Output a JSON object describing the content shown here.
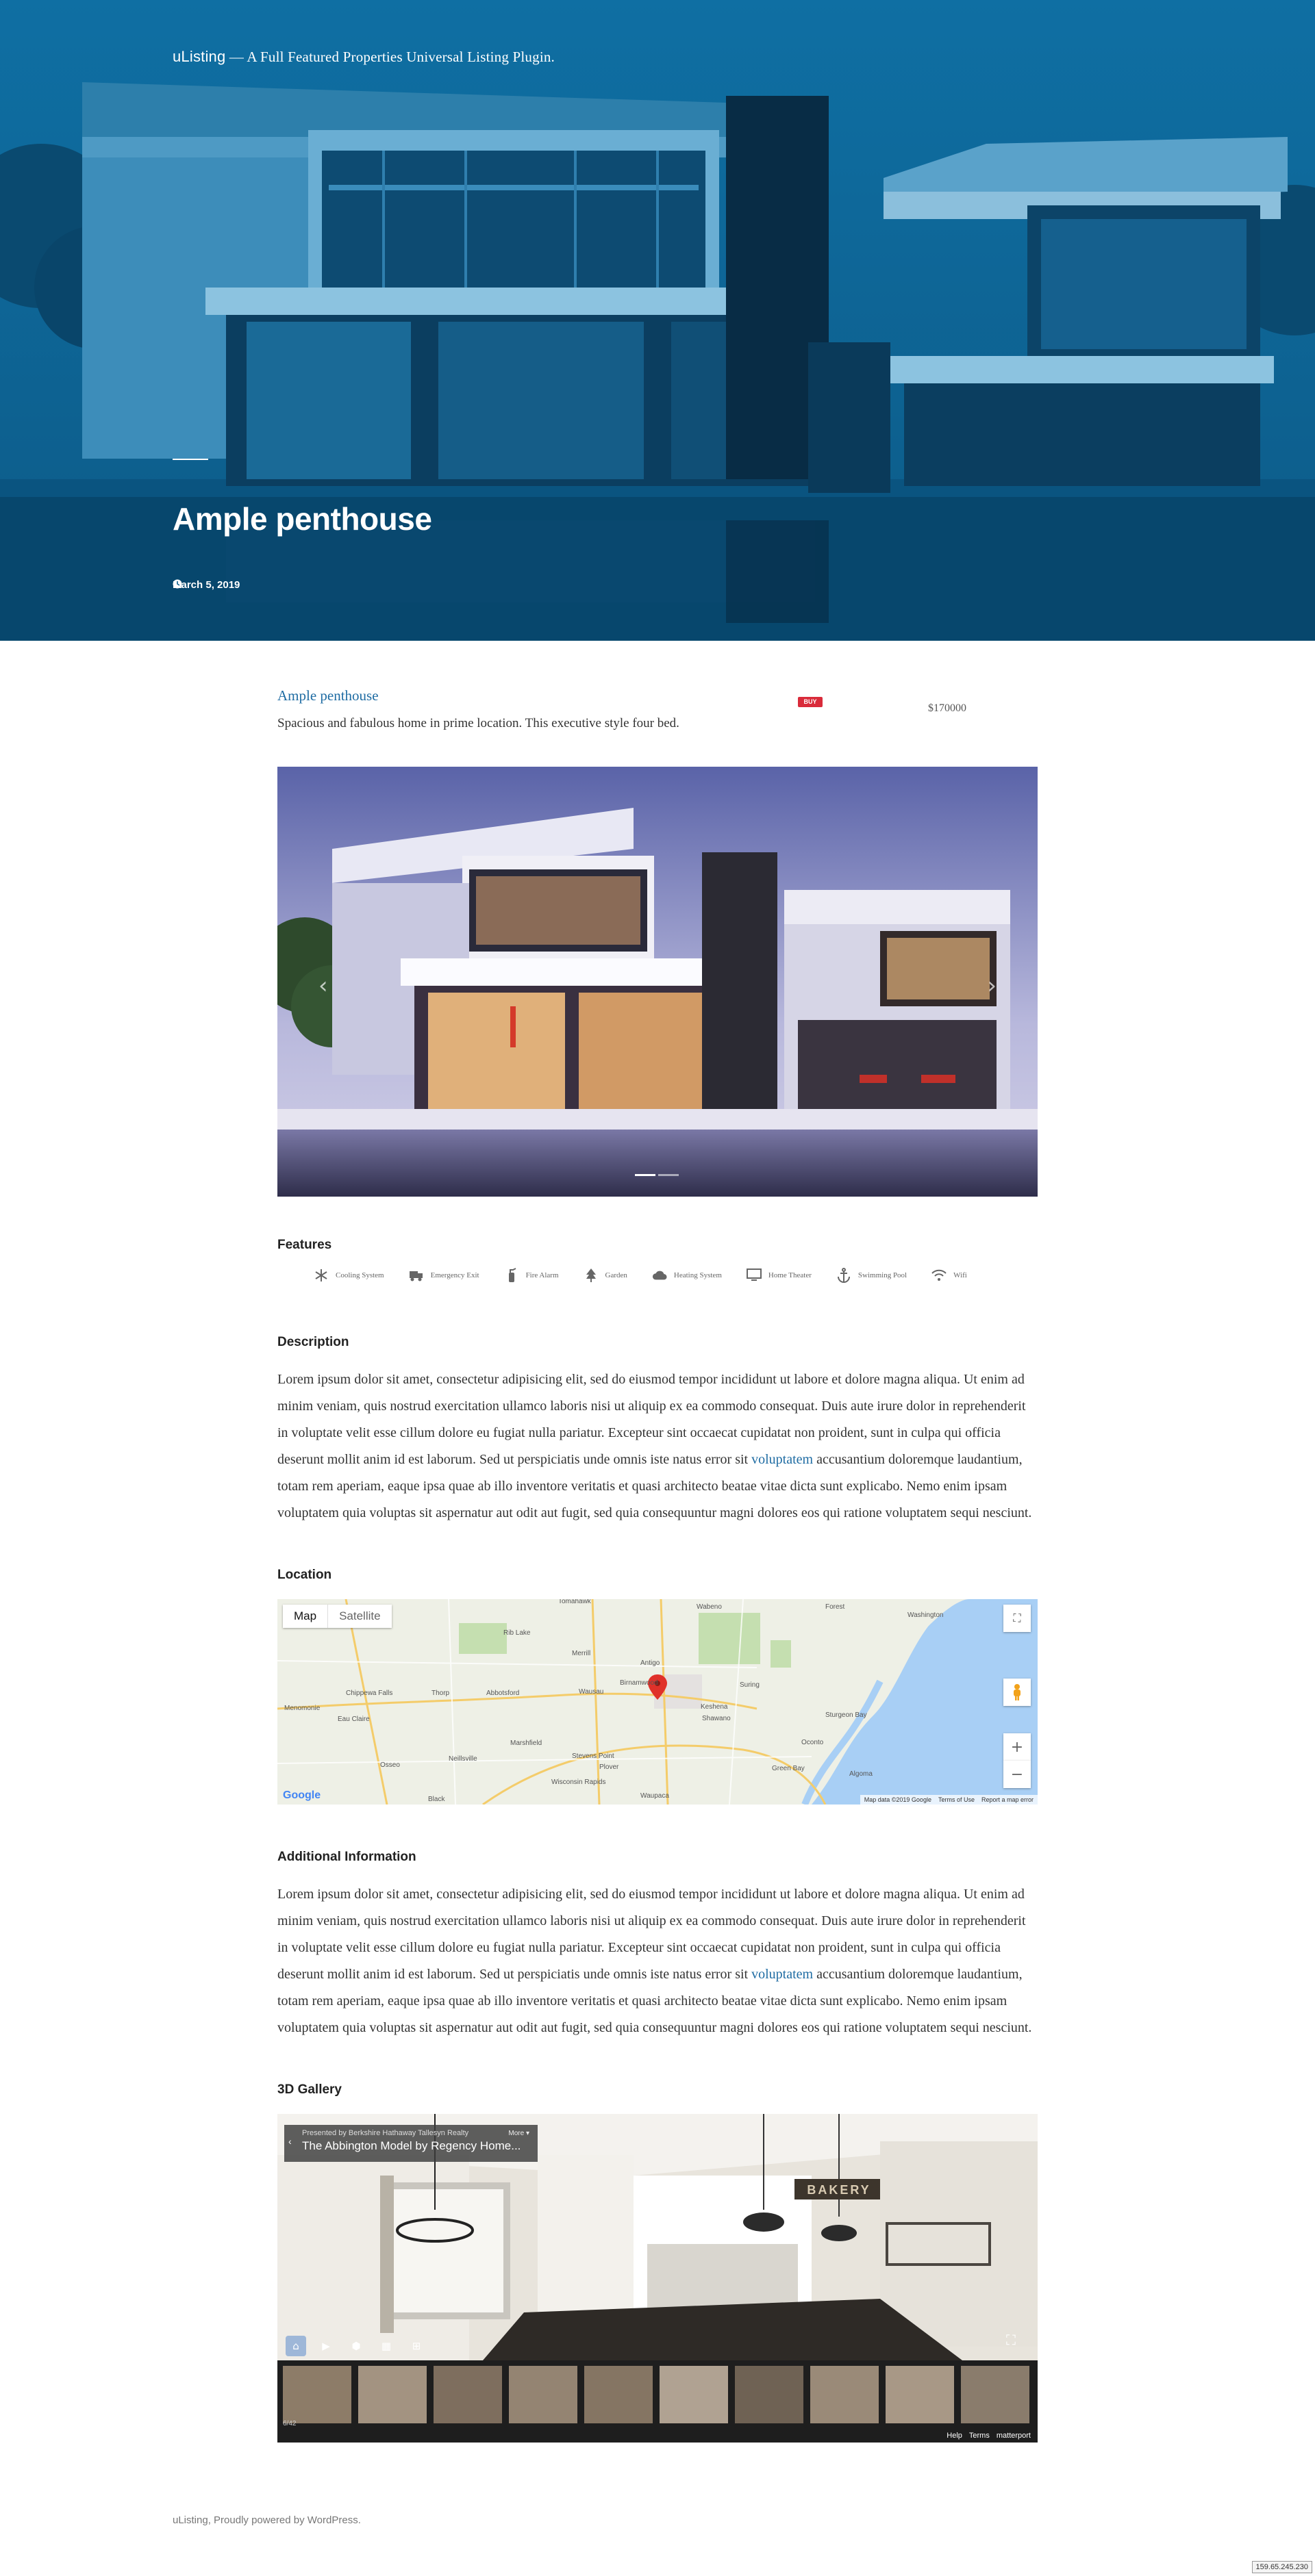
{
  "header": {
    "brand": "uListing",
    "separator": "—",
    "tagline": "A Full Featured Properties Universal Listing Plugin."
  },
  "hero": {
    "title": "Ample penthouse",
    "date": "March 5, 2019"
  },
  "listing": {
    "title": "Ample penthouse",
    "subtitle": "Spacious and fabulous home in prime location. This executive style four bed.",
    "badge": "BUY",
    "price": "$170000"
  },
  "features": {
    "heading": "Features",
    "items": [
      {
        "label": "Cooling System",
        "icon": "snowflake-icon"
      },
      {
        "label": "Emergency Exit",
        "icon": "truck-icon"
      },
      {
        "label": "Fire Alarm",
        "icon": "fire-extinguisher-icon"
      },
      {
        "label": "Garden",
        "icon": "tree-icon"
      },
      {
        "label": "Heating System",
        "icon": "cloud-icon"
      },
      {
        "label": "Home Theater",
        "icon": "monitor-icon"
      },
      {
        "label": "Swimming Pool",
        "icon": "anchor-icon"
      },
      {
        "label": "Wifi",
        "icon": "wifi-icon"
      }
    ]
  },
  "description": {
    "heading": "Description",
    "text_before": "Lorem ipsum dolor sit amet, consectetur adipisicing elit, sed do eiusmod tempor incididunt ut labore et dolore magna aliqua. Ut enim ad minim veniam, quis nostrud exercitation ullamco laboris nisi ut aliquip ex ea commodo consequat. Duis aute irure dolor in reprehenderit in voluptate velit esse cillum dolore eu fugiat nulla pariatur. Excepteur sint occaecat cupidatat non proident, sunt in culpa qui officia deserunt mollit anim id est laborum. Sed ut perspiciatis unde omnis iste natus error sit ",
    "link": "voluptatem",
    "text_after": " accusantium doloremque laudantium, totam rem aperiam, eaque ipsa quae ab illo inventore veritatis et quasi architecto beatae vitae dicta sunt explicabo. Nemo enim ipsam voluptatem quia voluptas sit aspernatur aut odit aut fugit, sed quia consequuntur magni dolores eos qui ratione voluptatem sequi nesciunt."
  },
  "location": {
    "heading": "Location",
    "map_button": "Map",
    "satellite_button": "Satellite",
    "places": [
      "Tomahawk",
      "Rib Lake",
      "Merrill",
      "Antigo",
      "Wabeno",
      "Forest",
      "Chippewa Falls",
      "Thorp",
      "Abbotsford",
      "Wausau",
      "Birnamwood",
      "Suring",
      "Eau Claire",
      "Marshfield",
      "Stevens Point",
      "Shawano",
      "Keshena",
      "Green Bay",
      "Menomonie",
      "Algoma",
      "Sturgeon Bay",
      "Washington",
      "Wisconsin Rapids",
      "Plover",
      "Waupaca",
      "Black",
      "Neillsville",
      "Osseo",
      "Oconto"
    ],
    "map_data": "Map data ©2019 Google",
    "terms": "Terms of Use",
    "report": "Report a map error",
    "google": "Google"
  },
  "additional": {
    "heading": "Additional Information",
    "text_before": "Lorem ipsum dolor sit amet, consectetur adipisicing elit, sed do eiusmod tempor incididunt ut labore et dolore magna aliqua. Ut enim ad minim veniam, quis nostrud exercitation ullamco laboris nisi ut aliquip ex ea commodo consequat. Duis aute irure dolor in reprehenderit in voluptate velit esse cillum dolore eu fugiat nulla pariatur. Excepteur sint occaecat cupidatat non proident, sunt in culpa qui officia deserunt mollit anim id est laborum. Sed ut perspiciatis unde omnis iste natus error sit ",
    "link": "voluptatem",
    "text_after": " accusantium doloremque laudantium, totam rem aperiam, eaque ipsa quae ab illo inventore veritatis et quasi architecto beatae vitae dicta sunt explicabo. Nemo enim ipsam voluptatem quia voluptas sit aspernatur aut odit aut fugit, sed quia consequuntur magni dolores eos qui ratione voluptatem sequi nesciunt."
  },
  "gallery3d": {
    "heading": "3D Gallery",
    "presented_by": "Presented by Berkshire Hathaway Tallesyn Realty",
    "more": "More",
    "tour_title": "The Abbington Model by Regency Home...",
    "sign": "BAKERY",
    "count": "6/42",
    "help": "Help",
    "terms": "Terms",
    "provider": "matterport"
  },
  "footer": {
    "text": "uListing, Proudly powered by WordPress."
  },
  "ip": "159.65.245.230",
  "colors": {
    "hero_blue": "#0b5e8d",
    "link_blue": "#1f6ca3",
    "badge_red": "#d92b3a"
  }
}
